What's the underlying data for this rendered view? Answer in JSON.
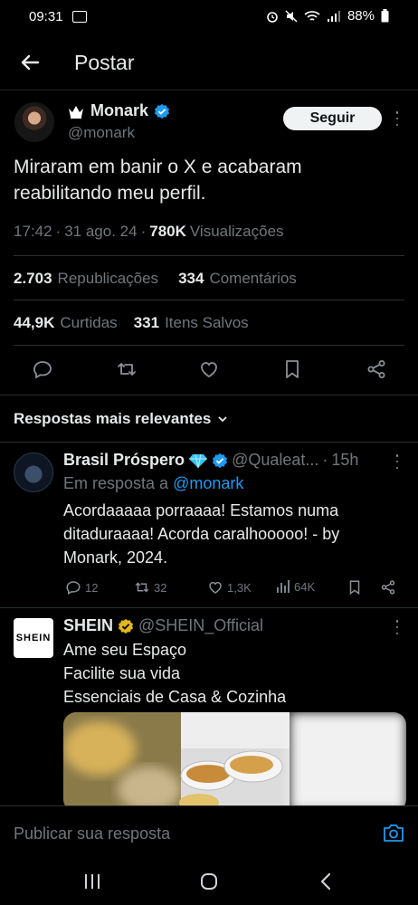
{
  "status_bar": {
    "time": "09:31",
    "battery": "88%"
  },
  "header": {
    "title": "Postar"
  },
  "post": {
    "author_name": "Monark",
    "author_handle": "@monark",
    "follow_label": "Seguir",
    "text": "Miraram em banir o X e acabaram reabilitando meu perfil.",
    "time": "17:42",
    "date": "31 ago. 24",
    "views": "780K",
    "views_label": "Visualizações",
    "reposts": "2.703",
    "reposts_label": "Republicações",
    "comments": "334",
    "comments_label": "Comentários",
    "likes": "44,9K",
    "likes_label": "Curtidas",
    "saves": "331",
    "saves_label": "Itens Salvos"
  },
  "replies_header": "Respostas mais relevantes",
  "replies": [
    {
      "name": "Brasil Próspero",
      "handle": "@Qualeat...",
      "time": "15h",
      "in_reply_prefix": "Em resposta a",
      "in_reply_to": "@monark",
      "text": "Acordaaaaa porraaaa! Estamos numa ditaduraaaa! Acorda caralhooooo! - by Monark, 2024.",
      "replies": "12",
      "reposts": "32",
      "likes": "1,3K",
      "views": "64K"
    },
    {
      "avatar_text": "SHEIN",
      "name": "SHEIN",
      "handle": "@SHEIN_Official",
      "lines": [
        "Ame seu Espaço",
        "Facilite sua vida",
        "Essenciais de Casa & Cozinha"
      ]
    }
  ],
  "reply_bar": {
    "placeholder": "Publicar sua resposta"
  },
  "colors": {
    "accent": "#1d9bf0",
    "verified_gold": "#e2b719",
    "background": "#000000"
  }
}
